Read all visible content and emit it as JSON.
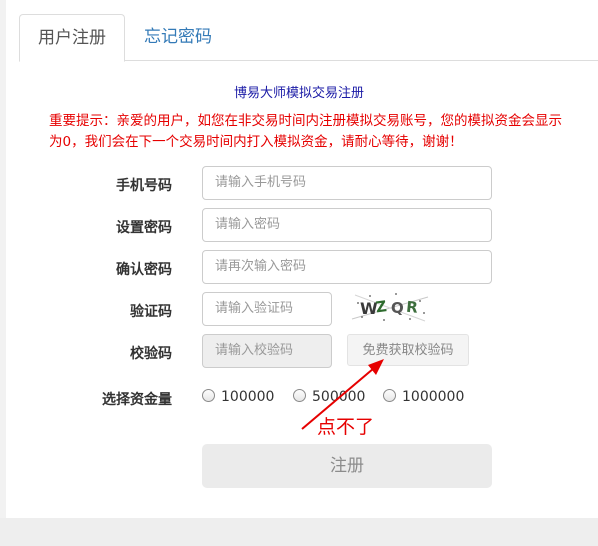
{
  "tabs": [
    {
      "label": "用户注册",
      "active": true
    },
    {
      "label": "忘记密码",
      "active": false
    }
  ],
  "form": {
    "title": "博易大师模拟交易注册",
    "notice": "重要提示：亲爱的用户，如您在非交易时间内注册模拟交易账号，您的模拟资金会显示为0，我们会在下一个交易时间内打入模拟资金，请耐心等待，谢谢！",
    "fields": [
      {
        "label": "手机号码",
        "placeholder": "请输入手机号码"
      },
      {
        "label": "设置密码",
        "placeholder": "请输入密码"
      },
      {
        "label": "确认密码",
        "placeholder": "请再次输入密码"
      },
      {
        "label": "验证码",
        "placeholder": "请输入验证码"
      },
      {
        "label": "校验码",
        "placeholder": "请输入校验码"
      }
    ],
    "captcha_text": "WZQR",
    "get_code_button": "免费获取校验码",
    "fund_label": "选择资金量",
    "fund_options": [
      "100000",
      "500000",
      "1000000"
    ],
    "submit": "注册"
  },
  "annotation": {
    "text": "点不了",
    "color": "#e60000"
  },
  "colors": {
    "notice": "#e60000",
    "title": "#1a1aa6",
    "tab_link": "#337ab7"
  }
}
